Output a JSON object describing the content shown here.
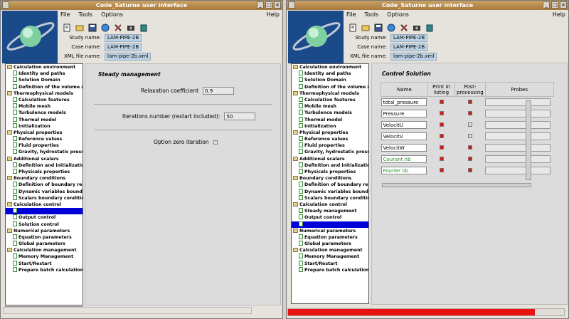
{
  "colors": {
    "title_bar": "#b8874a",
    "selection": "#0000d8",
    "marker_on": "#d41818",
    "progress": "#e81010",
    "info_value_bg": "#bcd3e6"
  },
  "window_left": {
    "title": "Code_Saturne user interface",
    "menu": [
      "File",
      "Tools",
      "Options"
    ],
    "help": "Help",
    "toolbar_icons": [
      "new-file-icon",
      "open-folder-icon",
      "save-icon",
      "globe-icon",
      "tools-icon",
      "camera-icon",
      "export-icon"
    ],
    "info": [
      {
        "label": "Study name:",
        "value": "LAM-PIPE-2B"
      },
      {
        "label": "Case name:",
        "value": "LAM-PIPE-2B"
      },
      {
        "label": "XML file name:",
        "value": "lam-pipe-2b.xml"
      }
    ],
    "panel": {
      "title": "Steady management",
      "relaxation_label": "Relaxation coefficient",
      "relaxation_value": "0.9",
      "iterations_label": "Iterations number (restart included):",
      "iterations_value": "50",
      "zero_iter_label": "Option zero iteration"
    }
  },
  "window_right": {
    "title": "Code_Saturne user interface",
    "menu": [
      "File",
      "Tools",
      "Options"
    ],
    "help": "Help",
    "info": [
      {
        "label": "Study name:",
        "value": "LAM-PIPE-2B"
      },
      {
        "label": "Case name:",
        "value": "LAM-PIPE-2B"
      },
      {
        "label": "XML file name:",
        "value": "lam-pipe-2b.xml"
      }
    ],
    "panel": {
      "title": "Control Solution",
      "headers": [
        "Name",
        "Print in listing",
        "Post-processing",
        "Probes"
      ],
      "rows": [
        {
          "name": "total_pressure",
          "print": true,
          "post": true,
          "green": false
        },
        {
          "name": "Pressure",
          "print": true,
          "post": true,
          "green": false
        },
        {
          "name": "VelocitU",
          "print": true,
          "post": false,
          "green": false
        },
        {
          "name": "VelocitV",
          "print": true,
          "post": false,
          "green": false
        },
        {
          "name": "VelocitW",
          "print": true,
          "post": true,
          "green": false
        },
        {
          "name": "Courant nb",
          "print": true,
          "post": true,
          "green": true
        },
        {
          "name": "Fourier nb",
          "print": true,
          "post": true,
          "green": true
        }
      ]
    },
    "progress": 0.89
  },
  "tree": [
    {
      "t": "f",
      "label": "Calculation environment"
    },
    {
      "t": "l",
      "label": "Identity and paths"
    },
    {
      "t": "l",
      "label": "Solution Domain"
    },
    {
      "t": "l",
      "label": "Definition of the volume zones"
    },
    {
      "t": "f",
      "label": "Thermophysical models"
    },
    {
      "t": "l",
      "label": "Calculation features"
    },
    {
      "t": "l",
      "label": "Mobile mesh"
    },
    {
      "t": "l",
      "label": "Turbulence models"
    },
    {
      "t": "l",
      "label": "Thermal model"
    },
    {
      "t": "l",
      "label": "Initialization"
    },
    {
      "t": "f",
      "label": "Physical properties"
    },
    {
      "t": "l",
      "label": "Reference values"
    },
    {
      "t": "l",
      "label": "Fluid properties"
    },
    {
      "t": "l",
      "label": "Gravity, hydrostatic pressure"
    },
    {
      "t": "f",
      "label": "Additional scalars"
    },
    {
      "t": "l",
      "label": "Definition and initialization"
    },
    {
      "t": "l",
      "label": "Physicals properties"
    },
    {
      "t": "f",
      "label": "Boundary conditions"
    },
    {
      "t": "l",
      "label": "Definition of boundary regions"
    },
    {
      "t": "l",
      "label": "Dynamic variables bound. cond."
    },
    {
      "t": "l",
      "label": "Scalars boundary conditions"
    },
    {
      "t": "f",
      "label": "Calculation control"
    },
    {
      "t": "l",
      "label": ""
    },
    {
      "t": "l",
      "label": "Output control"
    },
    {
      "t": "l",
      "label": "Solution control"
    },
    {
      "t": "f",
      "label": "Numerical parameters"
    },
    {
      "t": "l",
      "label": "Equation parameters"
    },
    {
      "t": "l",
      "label": "Global parameters"
    },
    {
      "t": "f",
      "label": "Calculation management"
    },
    {
      "t": "l",
      "label": "Memory Management"
    },
    {
      "t": "l",
      "label": "Start/Restart"
    },
    {
      "t": "l",
      "label": "Prepare batch calculation"
    }
  ],
  "tree_right": [
    {
      "t": "f",
      "label": "Calculation environment"
    },
    {
      "t": "l",
      "label": "Identity and paths"
    },
    {
      "t": "l",
      "label": "Solution Domain"
    },
    {
      "t": "l",
      "label": "Definition of the volume zones"
    },
    {
      "t": "f",
      "label": "Thermophysical models"
    },
    {
      "t": "l",
      "label": "Calculation features"
    },
    {
      "t": "l",
      "label": "Mobile mesh"
    },
    {
      "t": "l",
      "label": "Turbulence models"
    },
    {
      "t": "l",
      "label": "Thermal model"
    },
    {
      "t": "l",
      "label": "Initialization"
    },
    {
      "t": "f",
      "label": "Physical properties"
    },
    {
      "t": "l",
      "label": "Reference values"
    },
    {
      "t": "l",
      "label": "Fluid properties"
    },
    {
      "t": "l",
      "label": "Gravity, hydrostatic pressure"
    },
    {
      "t": "f",
      "label": "Additional scalars"
    },
    {
      "t": "l",
      "label": "Definition and initialization"
    },
    {
      "t": "l",
      "label": "Physicals properties"
    },
    {
      "t": "f",
      "label": "Boundary conditions"
    },
    {
      "t": "l",
      "label": "Definition of boundary regions"
    },
    {
      "t": "l",
      "label": "Dynamic variables bound. cond."
    },
    {
      "t": "l",
      "label": "Scalars boundary conditions"
    },
    {
      "t": "f",
      "label": "Calculation control"
    },
    {
      "t": "l",
      "label": "Steady management"
    },
    {
      "t": "l",
      "label": "Output control"
    },
    {
      "t": "l",
      "label": ""
    },
    {
      "t": "f",
      "label": "Numerical parameters"
    },
    {
      "t": "l",
      "label": "Equation parameters"
    },
    {
      "t": "l",
      "label": "Global parameters"
    },
    {
      "t": "f",
      "label": "Calculation management"
    },
    {
      "t": "l",
      "label": "Memory Management"
    },
    {
      "t": "l",
      "label": "Start/Restart"
    },
    {
      "t": "l",
      "label": "Prepare batch calculation"
    }
  ]
}
